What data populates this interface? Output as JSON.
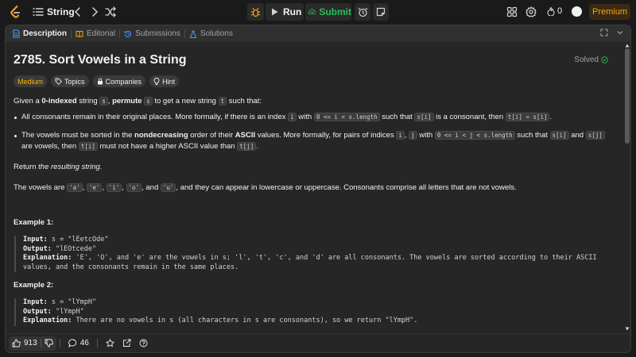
{
  "topbar": {
    "problem_list_label": "String",
    "run_label": "Run",
    "submit_label": "Submit",
    "streak_count": "0",
    "premium_label": "Premium"
  },
  "tabs": [
    {
      "label": "Description",
      "active": true
    },
    {
      "label": "Editorial",
      "active": false
    },
    {
      "label": "Submissions",
      "active": false
    },
    {
      "label": "Solutions",
      "active": false
    }
  ],
  "problem": {
    "title": "2785. Sort Vowels in a String",
    "status": "Solved",
    "tags": [
      "Medium",
      "Topics",
      "Companies",
      "Hint"
    ]
  },
  "description": {
    "intro_1": "Given a ",
    "intro_b1": "0-indexed",
    "intro_2": " string ",
    "intro_c1": "s",
    "intro_3": ", ",
    "intro_b2": "permute",
    "intro_4": " ",
    "intro_c2": "s",
    "intro_5": " to get a new string ",
    "intro_c3": "t",
    "intro_6": " such that:",
    "b1_1": "All consonants remain in their original places. More formally, if there is an index ",
    "b1_c1": "i",
    "b1_2": " with ",
    "b1_c2": "0 <= i < s.length",
    "b1_3": " such that ",
    "b1_c3": "s[i]",
    "b1_4": " is a consonant, then ",
    "b1_c4": "t[i] = s[i]",
    "b1_5": ".",
    "b2_1": "The vowels must be sorted in the ",
    "b2_b1": "nondecreasing",
    "b2_2": " order of their ",
    "b2_b2": "ASCII",
    "b2_3": " values. More formally, for pairs of indices ",
    "b2_c1": "i",
    "b2_4": ", ",
    "b2_c2": "j",
    "b2_5": " with ",
    "b2_c3": "0 <= i < j < s.length",
    "b2_6": " such that ",
    "b2_c4": "s[i]",
    "b2_7": " and ",
    "b2_c5": "s[j]",
    "b2_8": " are vowels, then ",
    "b2_c6": "t[i]",
    "b2_9": " must not have a higher ASCII value than ",
    "b2_c7": "t[j]",
    "b2_10": ".",
    "return_1": "Return ",
    "return_i": "the resulting string",
    "return_2": ".",
    "vowels_1": "The vowels are ",
    "vowels_c1": "'a'",
    "vowels_c2": "'e'",
    "vowels_c3": "'i'",
    "vowels_c4": "'o'",
    "vowels_and": ", and ",
    "vowels_c5": "'u'",
    "vowels_2": ", and they can appear in lowercase or uppercase. Consonants comprise all letters that are not vowels.",
    "comma": ", "
  },
  "examples": [
    {
      "title": "Example 1:",
      "input_label": "Input:",
      "input": " s = \"lEetcOde\"",
      "output_label": "Output:",
      "output": " \"lEOtcede\"",
      "explanation_label": "Explanation:",
      "explanation": " 'E', 'O', and 'e' are the vowels in s; 'l', 't', 'c', and 'd' are all consonants. The vowels are sorted according to their ASCII values, and the consonants remain in the same places."
    },
    {
      "title": "Example 2:",
      "input_label": "Input:",
      "input": " s = \"lYmpH\"",
      "output_label": "Output:",
      "output": " \"lYmpH\"",
      "explanation_label": "Explanation:",
      "explanation": " There are no vowels in s (all characters in s are consonants), so we return \"lYmpH\"."
    }
  ],
  "bottom": {
    "likes": "913",
    "comments": "46"
  },
  "colors": {
    "accent_green": "#2cbb5d",
    "premium_orange": "#ffa116",
    "medium_yellow": "#ffb800"
  }
}
